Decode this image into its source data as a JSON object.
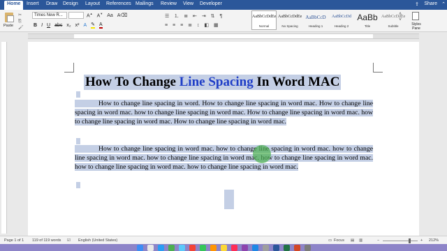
{
  "tabs": [
    {
      "label": "Home",
      "active": true
    },
    {
      "label": "Insert"
    },
    {
      "label": "Draw"
    },
    {
      "label": "Design"
    },
    {
      "label": "Layout"
    },
    {
      "label": "References"
    },
    {
      "label": "Mailings"
    },
    {
      "label": "Review"
    },
    {
      "label": "View"
    },
    {
      "label": "Developer"
    }
  ],
  "share_label": "Share",
  "ribbon": {
    "paste_label": "Paste",
    "font_name": "Times New R...",
    "font_size": "",
    "styles": [
      {
        "sample": "AaBbCcDdEe",
        "name": "Normal",
        "selected": true
      },
      {
        "sample": "AaBbCcDdEe",
        "name": "No Spacing"
      },
      {
        "sample": "AaBbCcD",
        "name": "Heading 1"
      },
      {
        "sample": "AaBbCcDd",
        "name": "Heading 2"
      },
      {
        "sample": "AaBb",
        "name": "Title"
      },
      {
        "sample": "AaBbCcDdEe",
        "name": "Subtitle"
      }
    ],
    "styles_pane_label": "Styles Pane"
  },
  "document": {
    "title_part1": "How To Change ",
    "title_part2": "Line Spacing",
    "title_part3": " In Word MAC",
    "paragraph1": "How to change line spacing in word. How to change line spacing in word mac. How to change line spacing in word mac. how to change line spacing in word mac. How to change line spacing in word mac. how to change line spacing in word mac. How to change line spacing in word mac.",
    "paragraph2": "How to change line spacing in word mac. how to change line spacing in word mac. how to change line spacing in word mac. how to change line spacing in word mac. how to change line spacing in word mac. how to change line spacing in word mac. how to change line spacing in word mac."
  },
  "status": {
    "page": "Page 1 of 1",
    "words": "119 of 119 words",
    "language": "English (United States)",
    "focus": "Focus",
    "zoom": "212%"
  },
  "colors": {
    "accent": "#2b579a",
    "selection": "#c4cfe5",
    "title_blue": "#1f3ec7"
  }
}
